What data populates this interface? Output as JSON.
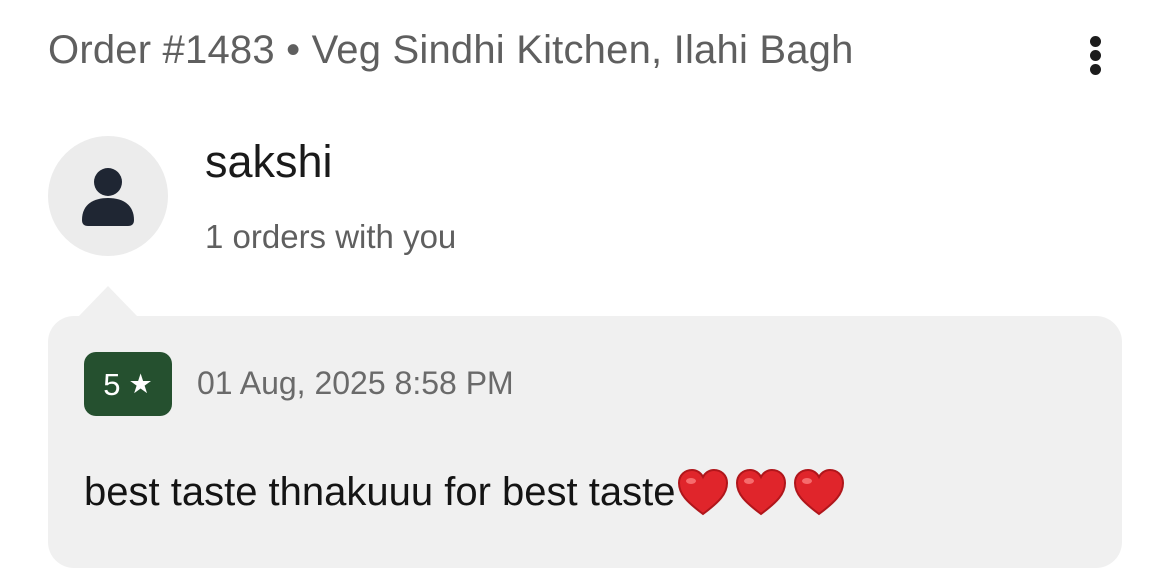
{
  "header": {
    "title": "Order #1483 • Veg Sindhi Kitchen, Ilahi Bagh",
    "more_icon": "more-vertical-icon"
  },
  "customer": {
    "name": "sakshi",
    "orders_text": "1 orders with you",
    "avatar_icon": "person-icon"
  },
  "review": {
    "rating": "5",
    "rating_icon": "star-icon",
    "datetime": "01 Aug, 2025 8:58 PM",
    "text": "best taste thnakuuu for best taste",
    "emoji": [
      "red-heart",
      "red-heart",
      "red-heart"
    ]
  },
  "colors": {
    "rating_badge": "#25502f",
    "heart": "#e0252b",
    "card_background": "#f0f0f0"
  }
}
